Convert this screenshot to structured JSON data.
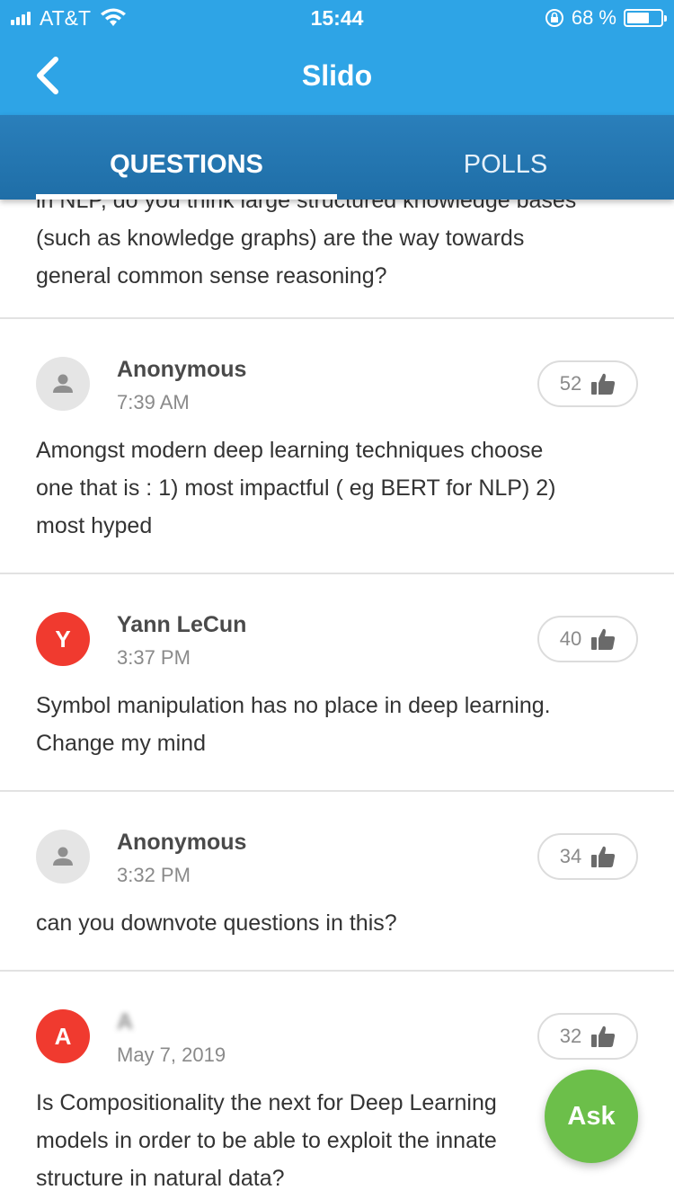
{
  "status_bar": {
    "carrier": "AT&T",
    "time": "15:44",
    "battery_percent": "68 %",
    "battery_level": 0.68
  },
  "nav": {
    "title": "Slido"
  },
  "tabs": [
    {
      "label": "QUESTIONS",
      "active": true
    },
    {
      "label": "POLLS",
      "active": false
    }
  ],
  "partial_question": {
    "lines": [
      "in NLP, do you think large structured knowledge bases",
      "(such as knowledge graphs) are the way towards",
      "general common sense reasoning?"
    ]
  },
  "questions": [
    {
      "author": "Anonymous",
      "avatar_letter": "",
      "avatar_type": "anonymous",
      "time": "7:39 AM",
      "likes": "52",
      "text_lines": [
        "Amongst modern deep learning techniques choose",
        "one that is : 1) most impactful ( eg BERT for NLP) 2)",
        "most hyped"
      ]
    },
    {
      "author": "Yann LeCun",
      "avatar_letter": "Y",
      "avatar_type": "letter",
      "time": "3:37 PM",
      "likes": "40",
      "text_lines": [
        "Symbol manipulation has no place in deep learning.",
        "Change my mind"
      ]
    },
    {
      "author": "Anonymous",
      "avatar_letter": "",
      "avatar_type": "anonymous",
      "time": "3:32 PM",
      "likes": "34",
      "text_lines": [
        "can you downvote questions in this?"
      ]
    },
    {
      "author": "A",
      "avatar_letter": "A",
      "avatar_type": "letter",
      "time": "May 7, 2019",
      "likes": "32",
      "text_lines": [
        "Is Compositionality the next for Deep Learning",
        "models in order to be able to exploit the innate",
        "structure in natural data?"
      ]
    }
  ],
  "fab": {
    "label": "Ask"
  },
  "colors": {
    "header": "#2ea4e6",
    "tabs": "#1f6ea7",
    "avatar_red": "#f03a2f",
    "fab_green": "#6cbf4a"
  }
}
